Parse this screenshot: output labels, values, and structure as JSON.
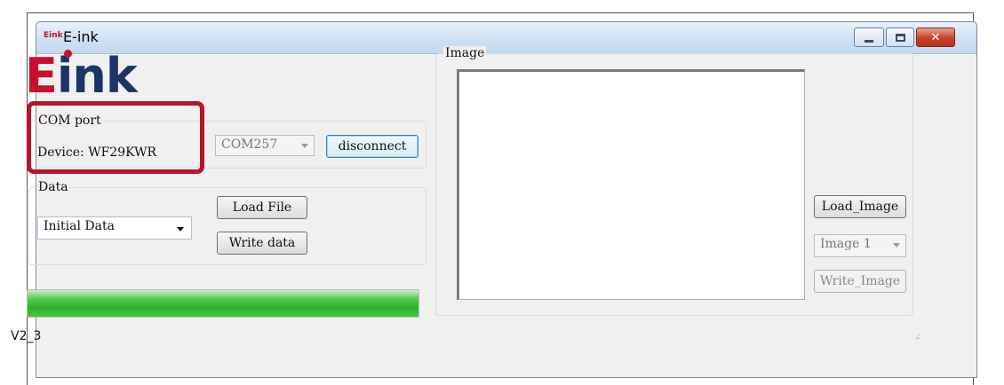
{
  "window": {
    "app_icon_text": "Eink",
    "title": "E-ink",
    "close_glyph": "✕"
  },
  "logo": {
    "letter_e": "E",
    "rest": "ink",
    "brand_red": "#c8102e",
    "brand_navy": "#1c3566"
  },
  "com_port": {
    "group_label": "COM port",
    "device_text": "Device: WF29KWR",
    "port_value": "COM257",
    "disconnect_label": "disconnect",
    "highlight_color": "#b8142a"
  },
  "data_section": {
    "group_label": "Data",
    "selected_value": "Initial Data",
    "load_file_label": "Load File",
    "write_data_label": "Write data"
  },
  "progress": {
    "percent": 100,
    "color": "#2bb02a"
  },
  "image_section": {
    "group_label": "Image",
    "load_image_label": "Load_Image",
    "selected_image": "Image 1",
    "write_image_label": "Write_Image"
  },
  "footer": {
    "version": "V2_3",
    "grip_glyph": ".:"
  }
}
